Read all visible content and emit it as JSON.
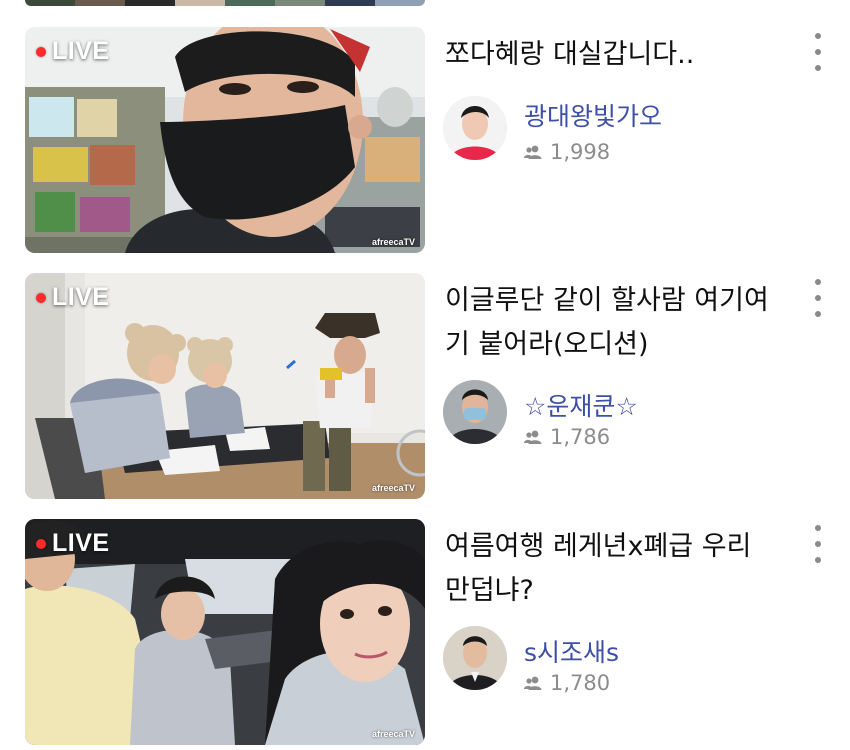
{
  "previous_card_strip": {
    "colors": [
      "#3c4a3a",
      "#6b5a4e",
      "#2a2a2a",
      "#c9b8a6",
      "#4c6a5a",
      "#7a8a78",
      "#2e3b52",
      "#8fa0b5"
    ]
  },
  "icons": {
    "live_dot": "live-dot-icon",
    "viewers": "viewers-icon",
    "more": "more-vertical-icon"
  },
  "colors": {
    "live_dot": "#ff2a2a",
    "streamer_name": "#3d4fa6",
    "meta": "#8c8c8c"
  },
  "streams": [
    {
      "live_label": "LIVE",
      "watermark": "afreecaTV",
      "title": "쪼다혜랑 대실갑니다..",
      "streamer": "광대왕빛가오",
      "viewers": "1,998"
    },
    {
      "live_label": "LIVE",
      "watermark": "afreecaTV",
      "title": "이글루단 같이 할사람 여기여기 붙어라(오디션)",
      "streamer": "☆운재쿤☆",
      "viewers": "1,786"
    },
    {
      "live_label": "LIVE",
      "watermark": "afreecaTV",
      "title": "여름여행 레게년x폐급 우리만덥냐?",
      "streamer": "s시조새s",
      "viewers": "1,780"
    }
  ]
}
